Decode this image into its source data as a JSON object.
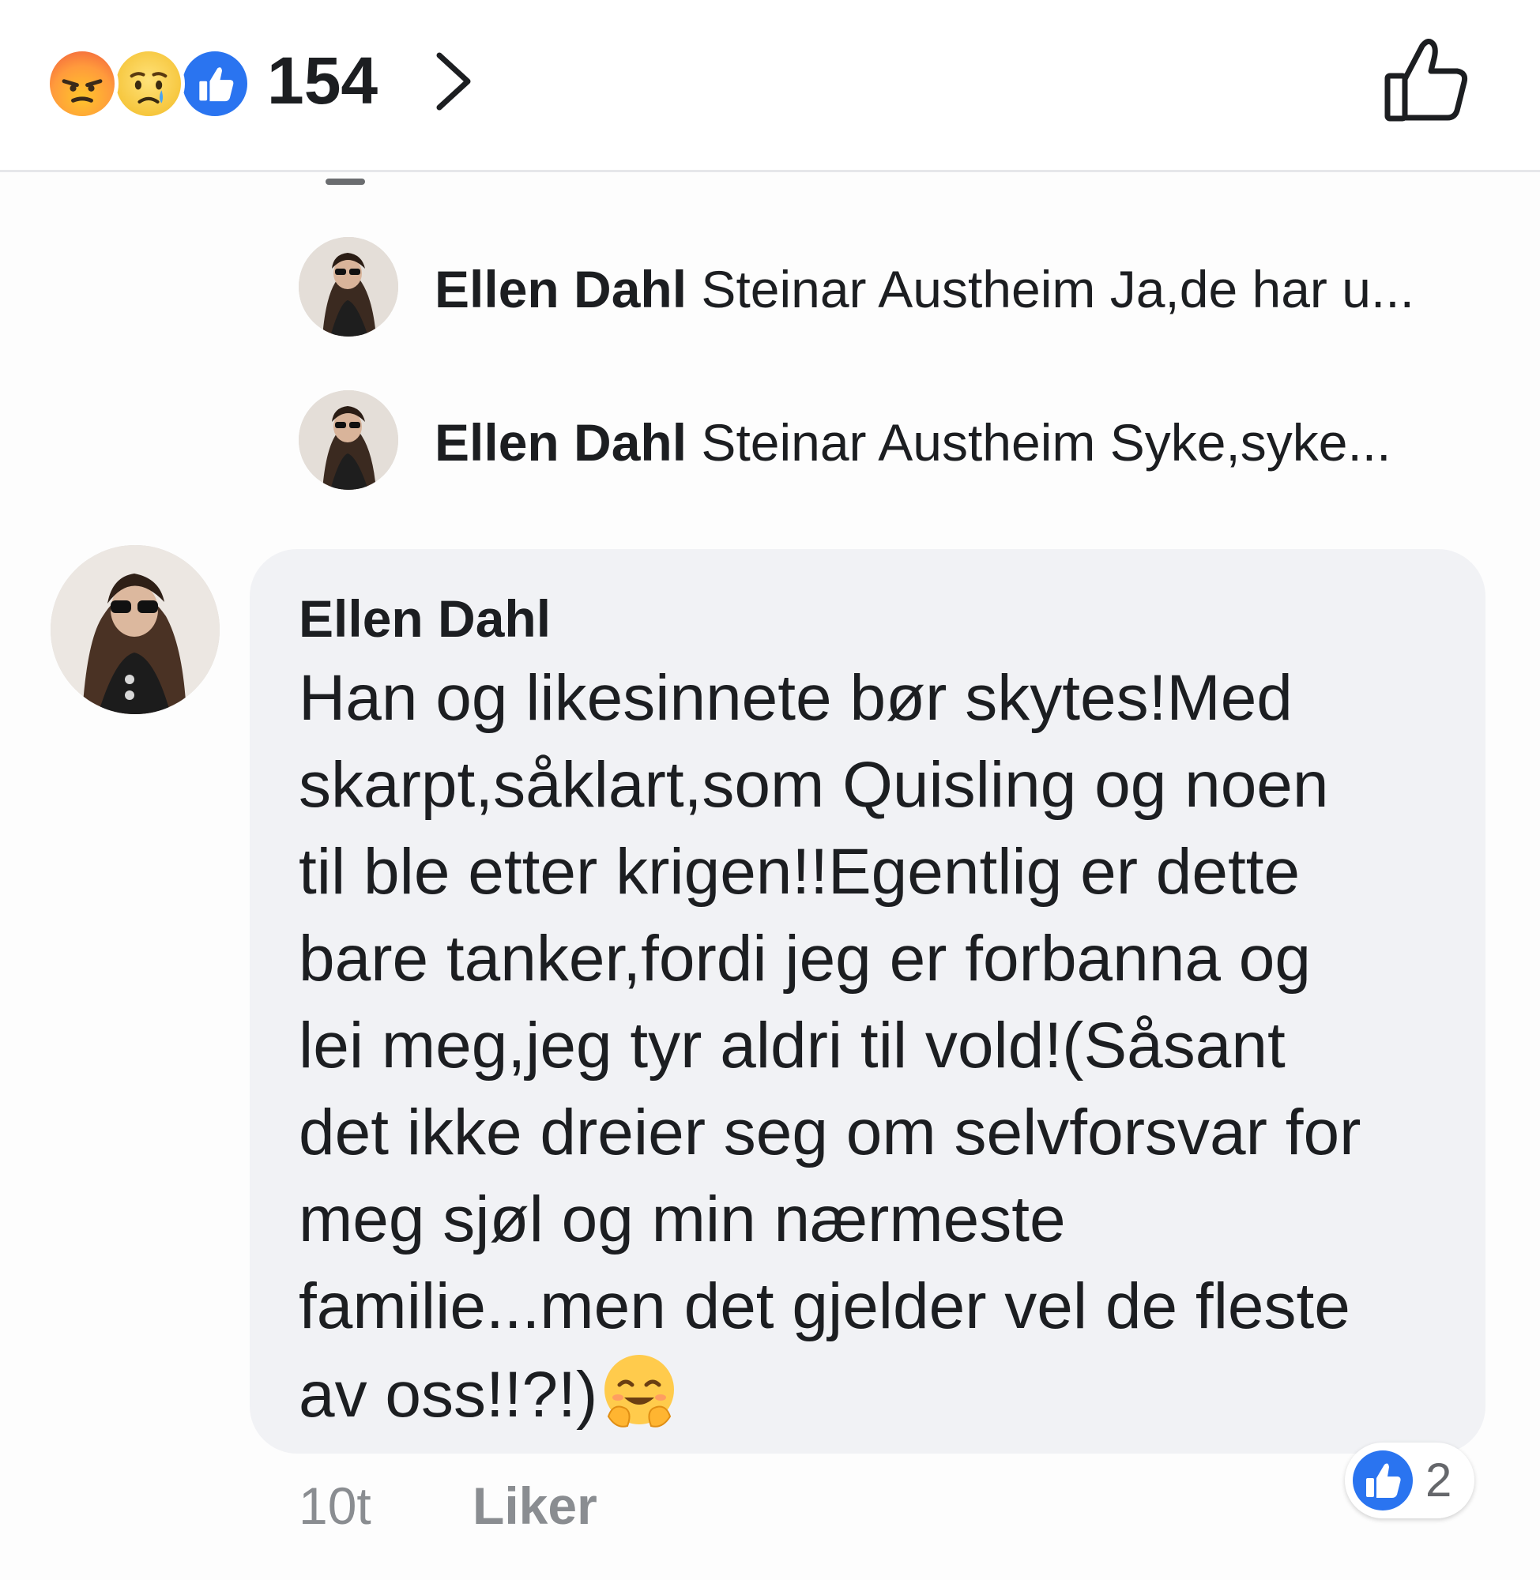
{
  "header": {
    "reactions": [
      {
        "type": "angry",
        "icon": "angry-face-icon"
      },
      {
        "type": "sad",
        "icon": "sad-face-icon"
      },
      {
        "type": "like",
        "icon": "like-icon"
      }
    ],
    "reaction_count": "154",
    "chevron_icon": "chevron-right-icon",
    "like_action_icon": "thumbs-up-outline-icon"
  },
  "replies": [
    {
      "author": "Ellen Dahl",
      "text": "Steinar Austheim Ja,de har u..."
    },
    {
      "author": "Ellen Dahl",
      "text": "Steinar Austheim Syke,syke..."
    }
  ],
  "comment": {
    "author": "Ellen Dahl",
    "lines": [
      "Han og likesinnete bør skytes!Med",
      "skarpt,såklart,som Quisling og noen",
      "til ble etter krigen!!Egentlig er dette",
      "bare tanker,fordi jeg er forbanna og",
      "lei meg,jeg tyr aldri til vold!(Såsant",
      "det ikke dreier seg om selvforsvar for",
      "meg sjøl og min nærmeste",
      "familie...men det gjelder vel de fleste",
      "av oss!!?!)"
    ],
    "trailing_emoji": "hugging-face-icon",
    "like_count": "2",
    "time": "10t",
    "like_label": "Liker"
  },
  "colors": {
    "like_blue": "#2a74f0",
    "bubble_bg": "#f1f2f5",
    "meta_gray": "#8a8d91"
  }
}
